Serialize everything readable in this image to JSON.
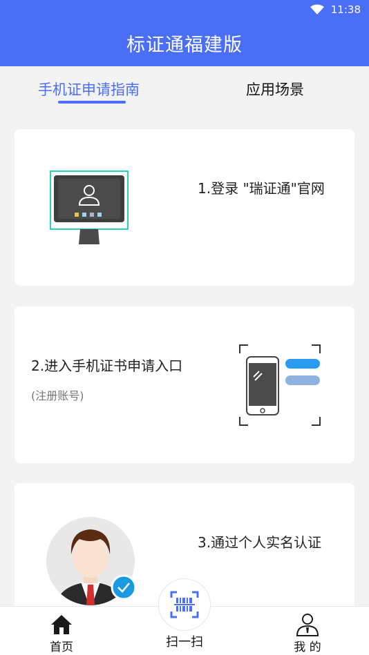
{
  "status_bar": {
    "time": "11:38",
    "icons": [
      "wifi-icon",
      "battery-icon"
    ]
  },
  "header": {
    "title": "标证通福建版"
  },
  "tabs": [
    {
      "label": "手机证申请指南",
      "active": true
    },
    {
      "label": "应用场景",
      "active": false
    }
  ],
  "steps": [
    {
      "title": "1.登录 \"瑞证通\"官网",
      "subtitle": "",
      "illustration": "monitor-icon"
    },
    {
      "title": "2.进入手机证书申请入口",
      "subtitle": "(注册账号)",
      "illustration": "phone-chat-icon"
    },
    {
      "title": "3.通过个人实名认证",
      "subtitle": "",
      "illustration": "avatar-verified-icon"
    }
  ],
  "bottom_nav": {
    "home_label": "首页",
    "scan_label": "扫一扫",
    "mine_label": "我 的"
  },
  "colors": {
    "primary": "#4a6ef5",
    "accent_teal": "#2bd1b8",
    "verified_blue": "#1a9be0"
  }
}
